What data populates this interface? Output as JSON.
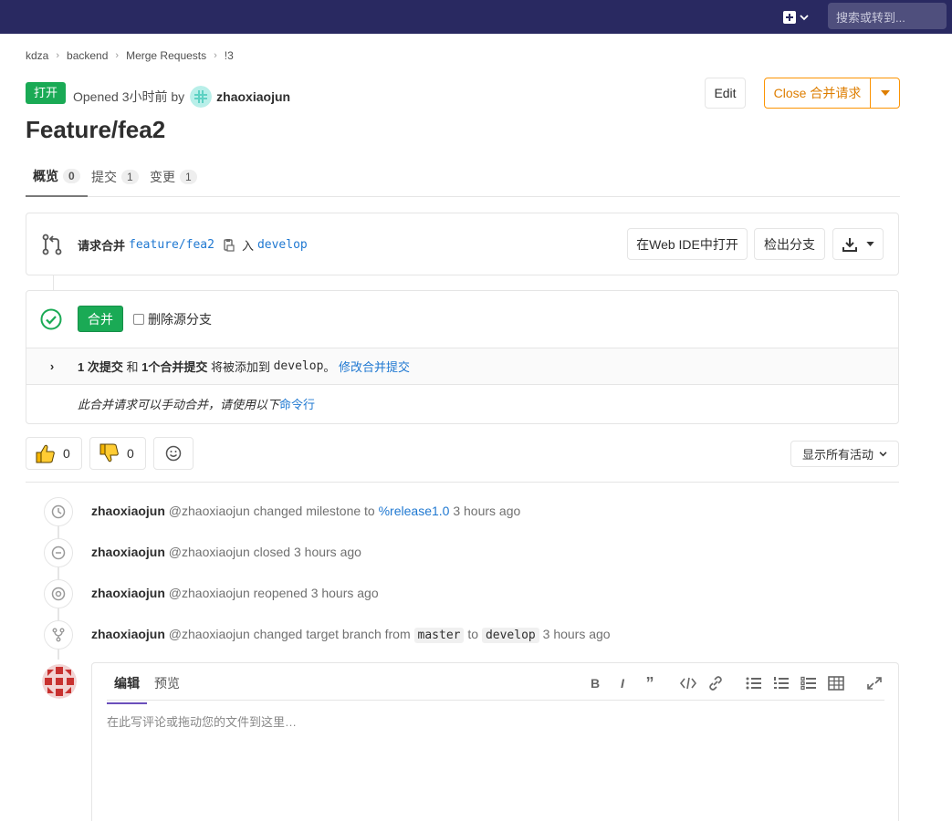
{
  "header": {
    "search_placeholder": "搜索或转到..."
  },
  "breadcrumb": [
    "kdza",
    "backend",
    "Merge Requests",
    "!3"
  ],
  "mr": {
    "status": "打开",
    "opened_prefix": "Opened 3小时前 by",
    "author": "zhaoxiaojun",
    "title": "Feature/fea2",
    "edit_label": "Edit",
    "close_label": "Close 合并请求"
  },
  "tabs": [
    {
      "label": "概览",
      "count": "0"
    },
    {
      "label": "提交",
      "count": "1"
    },
    {
      "label": "变更",
      "count": "1"
    }
  ],
  "widget": {
    "request_merge": "请求合并",
    "source_branch": "feature/fea2",
    "into": "入",
    "target_branch": "develop",
    "web_ide": "在Web IDE中打开",
    "checkout": "检出分支"
  },
  "merge": {
    "button": "合并",
    "delete_source": "删除源分支",
    "commits_count": "1 次提交",
    "and": "和",
    "merge_commit": "1个合并提交",
    "will_add_to": "将被添加到",
    "target": "develop",
    "period": "。",
    "modify_link": "修改合并提交",
    "manual_note": "此合并请求可以手动合并，请使用以下",
    "cmd_link": "命令行"
  },
  "awards": {
    "thumbs_up": "0",
    "thumbs_down": "0"
  },
  "filter": {
    "label": "显示所有活动"
  },
  "activity": [
    {
      "icon": "clock-icon",
      "user": "zhaoxiaojun",
      "handle": "@zhaoxiaojun",
      "action": "changed milestone to",
      "link": "%release1.0",
      "time": "3 hours ago"
    },
    {
      "icon": "closed-icon",
      "user": "zhaoxiaojun",
      "handle": "@zhaoxiaojun",
      "action": "closed",
      "time": "3 hours ago"
    },
    {
      "icon": "reopened-icon",
      "user": "zhaoxiaojun",
      "handle": "@zhaoxiaojun",
      "action": "reopened",
      "time": "3 hours ago"
    },
    {
      "icon": "branch-icon",
      "user": "zhaoxiaojun",
      "handle": "@zhaoxiaojun",
      "action": "changed target branch from",
      "from": "master",
      "to_word": "to",
      "to": "develop",
      "time": "3 hours ago"
    }
  ],
  "editor": {
    "tab_write": "编辑",
    "tab_preview": "预览",
    "placeholder": "在此写评论或拖动您的文件到这里…"
  },
  "colors": {
    "header": "#292961",
    "success": "#1aaa55",
    "warning": "#fc9403",
    "link": "#1f78d1"
  }
}
